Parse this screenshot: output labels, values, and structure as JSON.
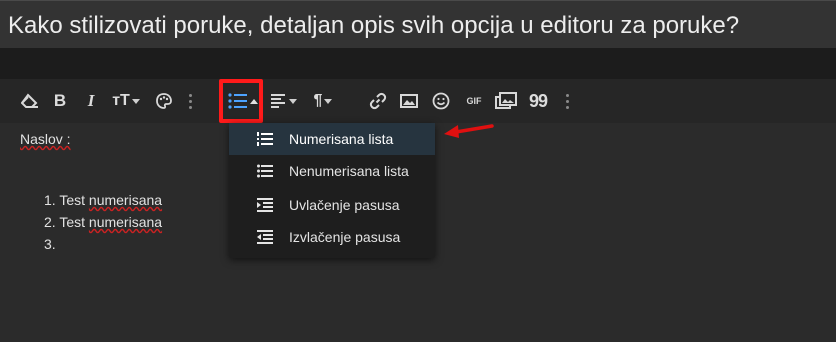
{
  "title": "Kako stilizovati poruke, detaljan opis svih opcija u editoru za poruke?",
  "toolbar": {
    "bold": "B",
    "italic": "I",
    "text_size": "тT",
    "paragraph": "¶",
    "gif": "GIF",
    "quote": "99",
    "icons": [
      "eraser-icon",
      "bold-icon",
      "italic-icon",
      "text-size-icon",
      "palette-icon",
      "more-icon",
      "list-icon",
      "align-icon",
      "paragraph-icon",
      "link-icon",
      "image-icon",
      "smiley-icon",
      "gif-icon",
      "media-icon",
      "quote-icon",
      "more-icon"
    ]
  },
  "content": {
    "heading": "Naslov :",
    "list_items": [
      "Test numerisana",
      "Test numerisana",
      ""
    ],
    "list_numbers": [
      "1.",
      "2.",
      "3."
    ]
  },
  "dropdown": {
    "items": [
      {
        "label": "Numerisana lista",
        "icon": "ordered-list-icon",
        "active": true
      },
      {
        "label": "Nenumerisana lista",
        "icon": "unordered-list-icon",
        "active": false
      },
      {
        "label": "Uvlačenje pasusa",
        "icon": "indent-icon",
        "active": false
      },
      {
        "label": "Izvlačenje pasusa",
        "icon": "outdent-icon",
        "active": false
      }
    ]
  },
  "colors": {
    "highlight": "#ff1a1a",
    "accent": "#4da3ff",
    "arrow": "#e01010"
  }
}
